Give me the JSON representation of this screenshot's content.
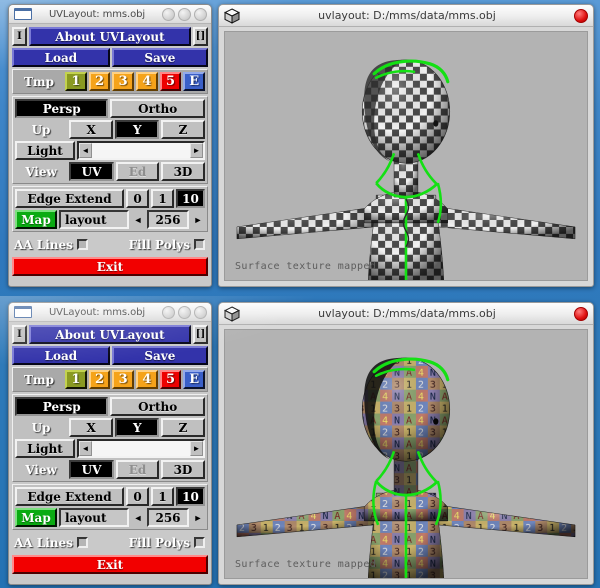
{
  "app": {
    "control_window_title": "UVLayout: mms.obj",
    "viewport_window_title": "uvlayout: D:/mms/data/mms.obj",
    "status_text": "Surface texture mapped"
  },
  "icons": {
    "window_icon": "window-icon",
    "cube_icon": "cube-icon",
    "close_icon": "close-icon",
    "minimize_icon": "minimize-icon",
    "maximize_icon": "maximize-icon",
    "restore_icon": "restore-icon",
    "left_arrow": "◄",
    "right_arrow": "►"
  },
  "panel": {
    "about_button": "About UVLayout",
    "left_small_button": "I",
    "right_small_button": "[]",
    "load_button": "Load",
    "save_button": "Save",
    "tmp_label": "Tmp",
    "tmp_buttons": [
      {
        "label": "1",
        "color": "#8a9a22"
      },
      {
        "label": "2",
        "color": "#f5a31a"
      },
      {
        "label": "3",
        "color": "#f5a31a"
      },
      {
        "label": "4",
        "color": "#f5a31a"
      },
      {
        "label": "5",
        "color": "#ee0000"
      },
      {
        "label": "E",
        "color": "#3a5fc8"
      }
    ],
    "projection": {
      "persp": "Persp",
      "ortho": "Ortho",
      "selected": "Persp"
    },
    "up": {
      "label": "Up",
      "options": [
        "X",
        "Y",
        "Z"
      ],
      "selected": "Y"
    },
    "light": {
      "label": "Light",
      "value": 0
    },
    "view": {
      "label": "View",
      "options": [
        "UV",
        "Ed",
        "3D"
      ],
      "selected": "UV",
      "disabled": "Ed"
    },
    "edge_extend": {
      "label": "Edge Extend",
      "options": [
        "0",
        "1",
        "10"
      ],
      "selected": "10"
    },
    "map": {
      "button": "Map",
      "value": "layout",
      "size": "256"
    },
    "aa_lines": {
      "label": "AA Lines",
      "checked": false
    },
    "fill_polys": {
      "label": "Fill Polys",
      "checked": false
    },
    "exit_button": "Exit"
  },
  "viewports": [
    {
      "texture": "checker",
      "status": "Surface texture mapped"
    },
    {
      "texture": "alphanumeric",
      "status": "Surface texture mapped"
    }
  ],
  "colors": {
    "desktop": "#2f78bd",
    "panel_face": "#c0c0c0",
    "blue_button": "#3333aa",
    "red_button": "#f20000",
    "green_button": "#0aab12",
    "viewport_bg": "#b3b3b3",
    "seam_green": "#14e014"
  }
}
